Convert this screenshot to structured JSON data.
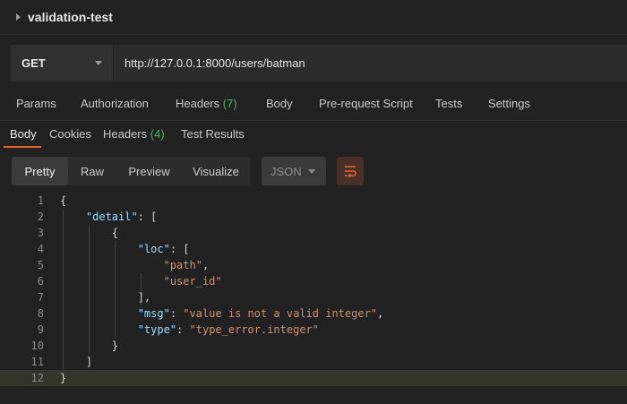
{
  "collection": {
    "name": "validation-test"
  },
  "request": {
    "method": "GET",
    "url": "http://127.0.0.1:8000/users/batman"
  },
  "request_tabs": [
    {
      "label": "Params"
    },
    {
      "label": "Authorization"
    },
    {
      "label": "Headers",
      "count": "(7)"
    },
    {
      "label": "Body"
    },
    {
      "label": "Pre-request Script"
    },
    {
      "label": "Tests"
    },
    {
      "label": "Settings"
    }
  ],
  "response_tabs": [
    {
      "label": "Body"
    },
    {
      "label": "Cookies"
    },
    {
      "label": "Headers",
      "count": "(4)"
    },
    {
      "label": "Test Results"
    }
  ],
  "view_modes": [
    "Pretty",
    "Raw",
    "Preview",
    "Visualize"
  ],
  "format": "JSON",
  "code": {
    "line_numbers": [
      "1",
      "2",
      "3",
      "4",
      "5",
      "6",
      "7",
      "8",
      "9",
      "10",
      "11",
      "12"
    ],
    "k_detail": "\"detail\"",
    "k_loc": "\"loc\"",
    "v_path": "\"path\"",
    "v_user_id": "\"user_id\"",
    "k_msg": "\"msg\"",
    "v_msg": "\"value is not a valid integer\"",
    "k_type": "\"type\"",
    "v_type": "\"type_error.integer\""
  },
  "colors": {
    "accent": "#e5622f",
    "count_green": "#4fb36b",
    "json_key": "#9cdcfe",
    "json_string": "#ce9178"
  },
  "icons": {
    "collection_toggle": "caret-right-icon",
    "method_dropdown": "chevron-down-icon",
    "wrap": "wrap-lines-icon"
  }
}
